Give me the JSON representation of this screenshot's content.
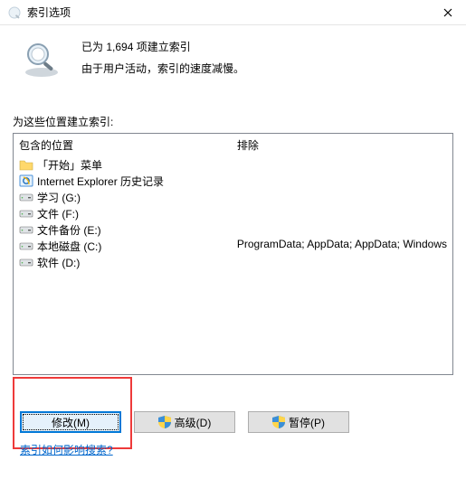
{
  "title": "索引选项",
  "summary": {
    "line1": "已为 1,694 项建立索引",
    "line2": "由于用户活动，索引的速度减慢。"
  },
  "section_label": "为这些位置建立索引:",
  "columns": {
    "included": "包含的位置",
    "excluded": "排除"
  },
  "locations": [
    {
      "icon": "folder",
      "label": "「开始」菜单",
      "exclude": ""
    },
    {
      "icon": "ie",
      "label": "Internet Explorer 历史记录",
      "exclude": ""
    },
    {
      "icon": "drive",
      "label": "学习 (G:)",
      "exclude": ""
    },
    {
      "icon": "drive",
      "label": "文件 (F:)",
      "exclude": ""
    },
    {
      "icon": "drive",
      "label": "文件备份 (E:)",
      "exclude": ""
    },
    {
      "icon": "drive",
      "label": "本地磁盘 (C:)",
      "exclude": "ProgramData; AppData; AppData; Windows"
    },
    {
      "icon": "drive",
      "label": "软件 (D:)",
      "exclude": ""
    }
  ],
  "buttons": {
    "modify": "修改(M)",
    "advanced": "高级(D)",
    "pause": "暂停(P)"
  },
  "help_link": "索引如何影响搜索?"
}
